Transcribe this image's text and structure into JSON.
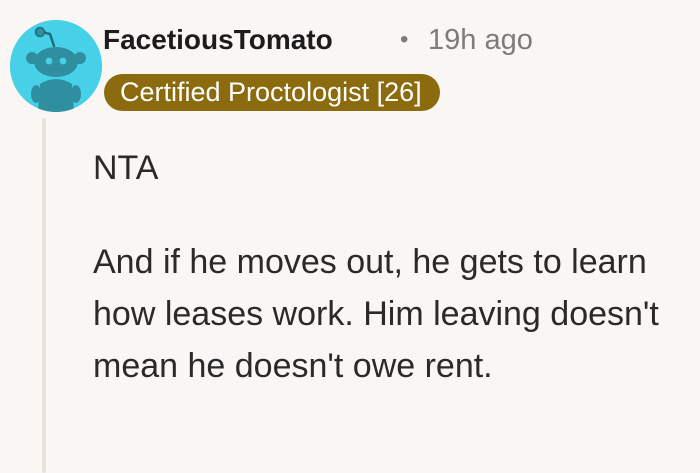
{
  "comment": {
    "author": "FacetiousTomato",
    "separator": "•",
    "time_ago": "19h ago",
    "flair": "Certified Proctologist [26]",
    "paragraphs": [
      "NTA",
      "And if he moves out, he gets to learn how leases work. Him leaving doesn't mean he doesn't owe rent."
    ]
  },
  "avatar": {
    "icon": "snoo-avatar-icon",
    "background_color": "#46d1e8"
  },
  "colors": {
    "flair_background": "#8b6b0e",
    "page_background": "#f9f6f4",
    "muted_text": "#7c7c7c"
  }
}
